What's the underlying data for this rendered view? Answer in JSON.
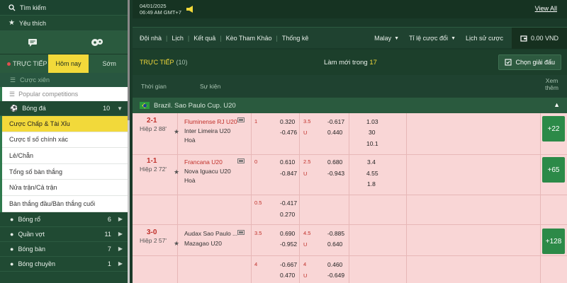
{
  "sidebar": {
    "search_label": "Tìm kiếm",
    "favorites_label": "Yêu thích",
    "tabs": {
      "live": "TRỰC TIẾP",
      "today": "Hôm nay",
      "early": "Sớm"
    },
    "cuoc_xien": "Cược xiên",
    "popular": "Popular competitions",
    "football": {
      "label": "Bóng đá",
      "count": "10"
    },
    "bet_types": [
      {
        "label": "Cược Chấp & Tài Xỉu",
        "active": true
      },
      {
        "label": "Cược tỉ số chính xác"
      },
      {
        "label": "Lẻ/Chẵn"
      },
      {
        "label": "Tổng số bàn thắng"
      },
      {
        "label": "Nửa trận/Cả trận"
      },
      {
        "label": "Bàn thắng đầu/Bàn thắng cuối"
      }
    ],
    "sports": [
      {
        "label": "Bóng rổ",
        "count": "6"
      },
      {
        "label": "Quần vợt",
        "count": "11"
      },
      {
        "label": "Bóng bàn",
        "count": "7"
      },
      {
        "label": "Bóng chuyền",
        "count": "1"
      }
    ]
  },
  "topbar": {
    "date": "04/01/2025",
    "time": "06:49 AM GMT+7",
    "view_all": "View All"
  },
  "nav": {
    "items": [
      "Đội nhà",
      "Lịch",
      "Kết quả",
      "Kèo Tham Khảo",
      "Thống kê"
    ],
    "odds_format": "Malay",
    "odds_change": "Tỉ lệ cược đổi",
    "bet_history": "Lịch sử cược",
    "balance": "0.00 VND"
  },
  "live_header": {
    "title": "TRỰC TIẾP",
    "count": "(10)",
    "refresh_prefix": "Làm mới trong",
    "refresh_seconds": "17",
    "choose_league": "Chọn giải đấu"
  },
  "columns": {
    "time": "Thời gian",
    "event": "Sự kiện",
    "more_l1": "Xem",
    "more_l2": "thêm"
  },
  "league": {
    "name": "Brazil. Sao Paulo Cup. U20"
  },
  "matches": [
    {
      "score": "2-1",
      "period": "Hiệp 2 88'",
      "home": "Fluminense RJ U20",
      "away": "Inter Limeira U20",
      "draw": "Hoà",
      "hdp": "1",
      "hdp_home": "0.320",
      "hdp_away": "-0.476",
      "ou": "3.5",
      "ou_u": "U",
      "ou_over": "-0.617",
      "ou_under": "0.440",
      "x12": [
        "1.03",
        "30",
        "10.1"
      ],
      "more": "+22"
    },
    {
      "score": "1-1",
      "period": "Hiệp 2 72'",
      "home": "Francana U20",
      "away": "Nova Iguacu U20",
      "draw": "Hoà",
      "hdp": "0",
      "hdp_home": "0.610",
      "hdp_away": "-0.847",
      "ou": "2.5",
      "ou_u": "U",
      "ou_over": "0.680",
      "ou_under": "-0.943",
      "x12": [
        "3.4",
        "4.55",
        "1.8"
      ],
      "more": "+65"
    },
    {
      "extra": true,
      "hdp": "0.5",
      "hdp_home": "-0.417",
      "hdp_away": "0.270"
    },
    {
      "score": "3-0",
      "period": "Hiệp 2 57'",
      "home": "Audax Sao Paulo ...",
      "away": "Mazagao U20",
      "hdp": "3.5",
      "hdp_home": "0.690",
      "hdp_away": "-0.952",
      "ou": "4.5",
      "ou_u": "U",
      "ou_over": "-0.885",
      "ou_under": "0.640",
      "more": "+128"
    },
    {
      "extra": true,
      "hdp": "4",
      "hdp_home": "-0.667",
      "hdp_away": "0.470",
      "ou": "4",
      "ou_u": "U",
      "ou_over": "0.460",
      "ou_under": "-0.649"
    }
  ],
  "colors": {
    "brand_green": "#204a33",
    "accent_yellow": "#f2d93a",
    "live_red": "#c0302a",
    "row_pink": "#f9d6d6"
  }
}
